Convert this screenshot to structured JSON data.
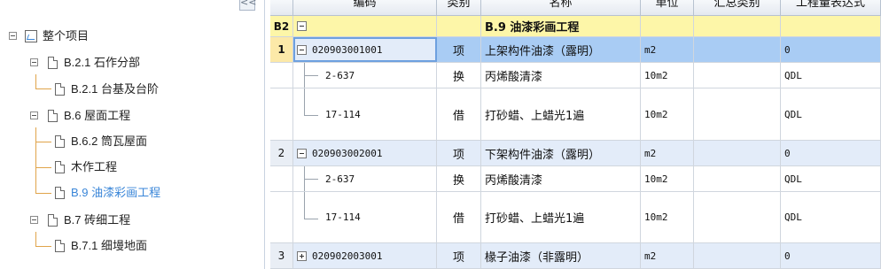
{
  "tree": {
    "collapse_label": "<<",
    "root": "整个项目",
    "items": [
      {
        "label": "B.2.1 石作分部"
      },
      {
        "label": "B.2.1 台基及台阶"
      },
      {
        "label": "B.6 屋面工程"
      },
      {
        "label": "B.6.2 筒瓦屋面"
      },
      {
        "label": "木作工程"
      },
      {
        "label": "B.9 油漆彩画工程"
      },
      {
        "label": "B.7 砖细工程"
      },
      {
        "label": "B.7.1 细墁地面"
      }
    ]
  },
  "grid": {
    "headers": [
      "编码",
      "类别",
      "名称",
      "单位",
      "汇总类别",
      "工程量表达式"
    ],
    "rows": [
      {
        "rn": "B2",
        "code": "",
        "type": "",
        "name": "B.9 油漆彩画工程",
        "unit": "",
        "sum": "",
        "expr": ""
      },
      {
        "rn": "1",
        "code": "020903001001",
        "type": "项",
        "name": "上架构件油漆（露明）",
        "unit": "m2",
        "sum": "",
        "expr": "0"
      },
      {
        "rn": "",
        "code": "2-637",
        "type": "换",
        "name": "丙烯酸清漆",
        "unit": "10m2",
        "sum": "",
        "expr": "QDL"
      },
      {
        "rn": "",
        "code": "17-114",
        "type": "借",
        "name": "打砂蜡、上蜡光1遍",
        "unit": "10m2",
        "sum": "",
        "expr": "QDL"
      },
      {
        "rn": "2",
        "code": "020903002001",
        "type": "项",
        "name": "下架构件油漆（露明）",
        "unit": "m2",
        "sum": "",
        "expr": "0"
      },
      {
        "rn": "",
        "code": "2-637",
        "type": "换",
        "name": "丙烯酸清漆",
        "unit": "10m2",
        "sum": "",
        "expr": "QDL"
      },
      {
        "rn": "",
        "code": "17-114",
        "type": "借",
        "name": "打砂蜡、上蜡光1遍",
        "unit": "10m2",
        "sum": "",
        "expr": "QDL"
      },
      {
        "rn": "3",
        "code": "020902003001",
        "type": "项",
        "name": "椽子油漆（非露明）",
        "unit": "m2",
        "sum": "",
        "expr": "0"
      }
    ]
  },
  "colors": {
    "selected_tree": "#3a86d8",
    "section_row": "#fdf6a8",
    "selected_row": "#a9ccf4",
    "item_row": "#e3ecf9"
  }
}
